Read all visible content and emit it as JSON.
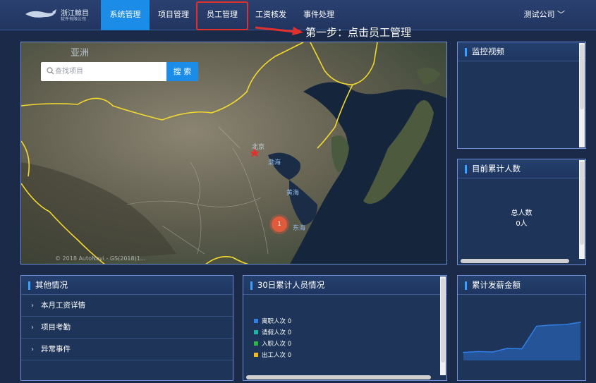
{
  "header": {
    "logo_line1": "浙江鲸目",
    "logo_line2": "软件有限公司",
    "nav": [
      {
        "label": "系统管理",
        "active": true
      },
      {
        "label": "项目管理",
        "active": false
      },
      {
        "label": "员工管理",
        "active": false
      },
      {
        "label": "工资核发",
        "active": false
      },
      {
        "label": "事件处理",
        "active": false
      }
    ],
    "company": "测试公司 ﹀",
    "annotation": "第一步：点击员工管理"
  },
  "map": {
    "search_placeholder": "查找项目",
    "search_button": "搜 索",
    "labels": {
      "region": "亚洲",
      "capital": "北京",
      "bohai": "渤海",
      "yellow_sea": "黄海",
      "east_sea": "东海"
    },
    "cluster_count": "1",
    "copyright": "© 2018 AutoNavi - GS(2018)1..."
  },
  "panels": {
    "video": {
      "title": "监控视频"
    },
    "headcount": {
      "title": "目前累计人数",
      "label": "总人数",
      "value": "0人"
    },
    "others": {
      "title": "其他情况",
      "items": [
        "本月工资详情",
        "项目考勤",
        "异常事件"
      ]
    },
    "thirty_day": {
      "title": "30日累计人员情况",
      "legend": [
        {
          "label": "离职人次 0",
          "color": "#2f7fe6"
        },
        {
          "label": "请假人次 0",
          "color": "#1fb5a5"
        },
        {
          "label": "入职人次 0",
          "color": "#2db34a"
        },
        {
          "label": "出工人次 0",
          "color": "#f2b81f"
        }
      ]
    },
    "payroll": {
      "title": "累计发薪金额"
    }
  },
  "chart_data": {
    "type": "area",
    "title": "累计发薪金额",
    "values": [
      2,
      2.2,
      2.1,
      3,
      2.9,
      8.5,
      8.8,
      8.9,
      9.5
    ],
    "ylim": [
      0,
      14
    ],
    "color": "#2f7fe6"
  }
}
